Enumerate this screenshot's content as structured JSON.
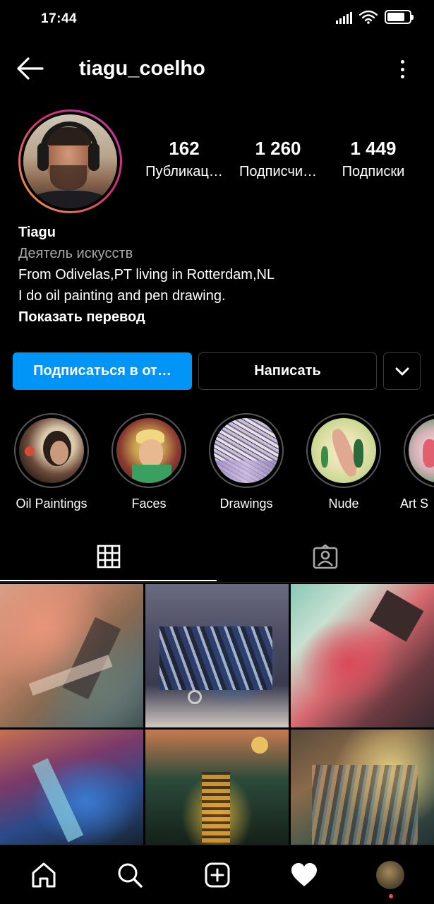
{
  "status_bar": {
    "time": "17:44",
    "battery_level": 0.8
  },
  "header": {
    "username": "tiagu_coelho",
    "back_icon": "arrow-left-icon",
    "more_icon": "more-vertical-icon"
  },
  "profile": {
    "stats": [
      {
        "value": "162",
        "label": "Публикац…"
      },
      {
        "value": "1 260",
        "label": "Подписчи…"
      },
      {
        "value": "1 449",
        "label": "Подписки"
      }
    ],
    "name": "Tiagu",
    "category": "Деятель искусств",
    "bio_lines": [
      "From Odivelas,PT living in Rotterdam,NL",
      "I do oil painting and pen drawing."
    ],
    "translate_link": "Показать перевод"
  },
  "actions": {
    "follow_label": "Подписаться в от…",
    "message_label": "Написать",
    "more_icon": "chevron-down-icon"
  },
  "highlights": [
    {
      "label": "Oil Paintings"
    },
    {
      "label": "Faces"
    },
    {
      "label": "Drawings"
    },
    {
      "label": "Nude"
    },
    {
      "label": "Art S"
    }
  ],
  "tabs": [
    {
      "icon": "grid-icon",
      "active": true
    },
    {
      "icon": "tagged-icon",
      "active": false
    }
  ],
  "bottom_nav": [
    "home-icon",
    "search-icon",
    "add-post-icon",
    "activity-heart-icon",
    "profile-avatar"
  ],
  "colors": {
    "accent": "#0095f6",
    "background": "#000000",
    "secondary_text": "#a8a8a8",
    "notification_dot": "#ed4956"
  }
}
